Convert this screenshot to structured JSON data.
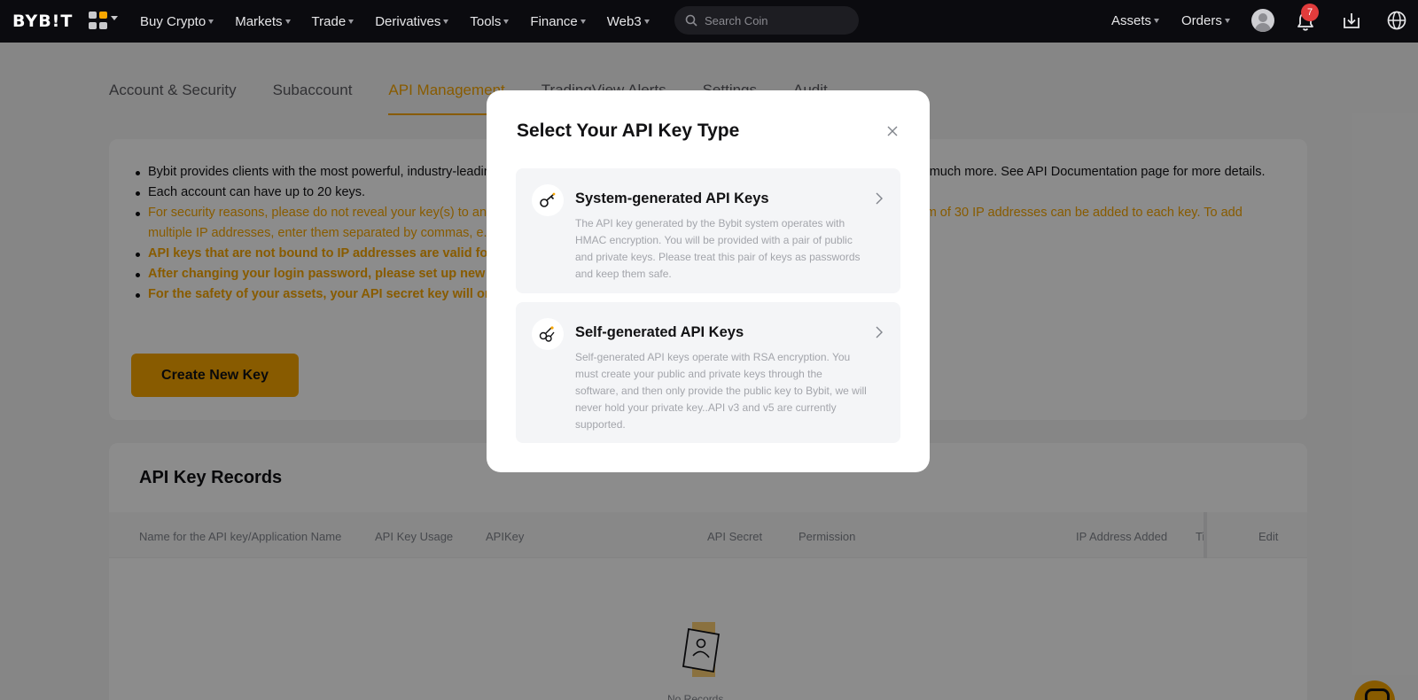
{
  "nav": {
    "logo": "BYB!T",
    "menu": [
      {
        "label": "Buy Crypto"
      },
      {
        "label": "Markets"
      },
      {
        "label": "Trade"
      },
      {
        "label": "Derivatives"
      },
      {
        "label": "Tools"
      },
      {
        "label": "Finance"
      },
      {
        "label": "Web3"
      }
    ],
    "search_placeholder": "Search Coin",
    "assets_label": "Assets",
    "orders_label": "Orders",
    "notification_count": "7"
  },
  "tabs": [
    {
      "label": "Account & Security"
    },
    {
      "label": "Subaccount"
    },
    {
      "label": "API Management"
    },
    {
      "label": "TradingView Alerts"
    },
    {
      "label": "Settings"
    },
    {
      "label": "Audit"
    }
  ],
  "info": [
    {
      "text": "Bybit provides clients with the most powerful, industry-leading API to allow you to pull market data, perform automated trading orders and much more. See API Documentation page for more details."
    },
    {
      "text": "Each account can have up to 20 keys."
    },
    {
      "text": "For security reasons, please do not reveal your key(s) to anyone. We recommend binding IP addresses to each of the API key. A maximum of 30 IP addresses can be added to each key. To add multiple IP addresses, enter them separated by commas, e.g. 192.168.1.1,192.168.1.2,192.168.1.3"
    },
    {
      "text": "API keys that are not bound to IP addresses are valid for three months; keys bound to IP addresses are permanently valid."
    },
    {
      "text": "After changing your login password, please set up new API keys."
    },
    {
      "text": "For the safety of your assets, your API secret key will only be displayed once; please store your API keys securely."
    }
  ],
  "create_button": "Create New Key",
  "records": {
    "title": "API Key Records",
    "columns": [
      "Name for the API key/Application Name",
      "API Key Usage",
      "APIKey",
      "API Secret",
      "Permission",
      "IP Address Added",
      "Ti",
      "Edit"
    ],
    "empty_text": "No Records"
  },
  "modal": {
    "title": "Select Your API Key Type",
    "options": [
      {
        "title": "System-generated API Keys",
        "desc": "The API key generated by the Bybit system operates with HMAC encryption. You will be provided with a pair of public and private keys. Please treat this pair of keys as passwords and keep them safe.",
        "icon": "key-icon"
      },
      {
        "title": "Self-generated API Keys",
        "desc": "Self-generated API keys operate with RSA encryption. You must create your public and private keys through the software, and then only provide the public key to Bybit, we will never hold your private key..API v3 and v5 are currently supported.",
        "icon": "keys-icon"
      }
    ]
  },
  "colors": {
    "brand": "#f7a600",
    "nav_bg": "#0b0b0f",
    "badge": "#e23c3c"
  }
}
